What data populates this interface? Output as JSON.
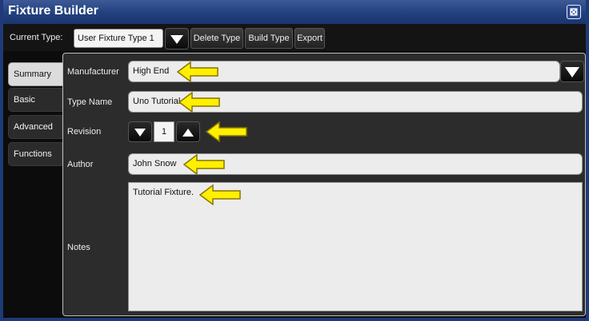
{
  "window": {
    "title": "Fixture Builder",
    "close_glyph": "⊠"
  },
  "toolbar": {
    "current_type_label": "Current Type:",
    "current_type_value": "User Fixture Type 1",
    "delete_label": "Delete Type",
    "build_label": "Build Type",
    "export_label": "Export"
  },
  "tabs": [
    {
      "label": "Summary",
      "active": true
    },
    {
      "label": "Basic",
      "active": false
    },
    {
      "label": "Advanced",
      "active": false
    },
    {
      "label": "Functions",
      "active": false
    }
  ],
  "form": {
    "manufacturer": {
      "label": "Manufacturer",
      "value": "High End"
    },
    "type_name": {
      "label": "Type Name",
      "value": "Uno Tutorial"
    },
    "revision": {
      "label": "Revision",
      "value": "1"
    },
    "author": {
      "label": "Author",
      "value": "John Snow"
    },
    "notes": {
      "label": "Notes",
      "value": "Tutorial Fixture."
    }
  },
  "colors": {
    "titlebar": "#22407e",
    "background": "#0c0c0c",
    "panel": "#2c2c2c",
    "field": "#ececec",
    "arrow_fill": "#ffef00",
    "arrow_stroke": "#8a7400"
  }
}
